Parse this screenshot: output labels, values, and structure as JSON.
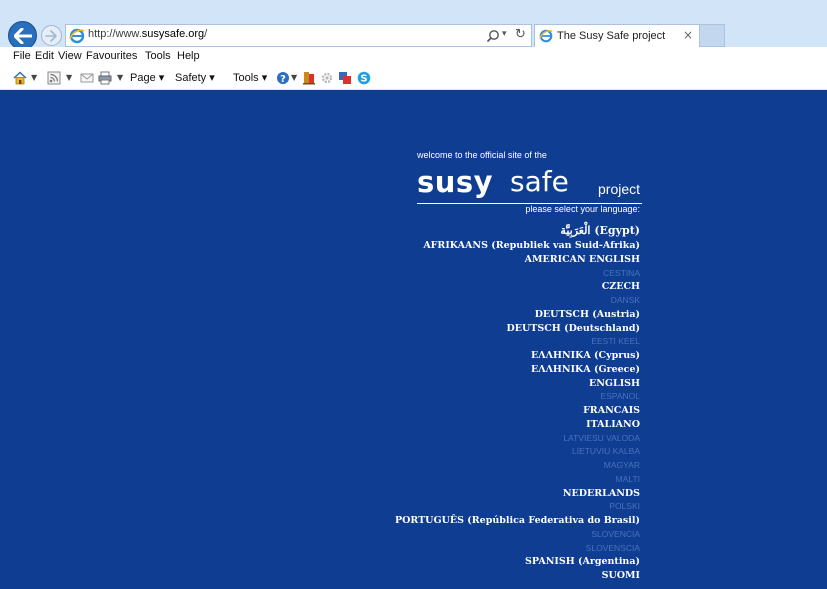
{
  "browser": {
    "url_prefix": "http://www.",
    "url_domain": "susysafe.org",
    "url_suffix": "/",
    "tab_title": "The Susy Safe project",
    "tab_close": "×"
  },
  "menu": {
    "file": "File",
    "edit": "Edit",
    "view": "View",
    "favourites": "Favourites",
    "tools": "Tools",
    "help": "Help"
  },
  "commandbar": {
    "page": "Page",
    "safety": "Safety",
    "tools": "Tools"
  },
  "page": {
    "welcome": "welcome to the official site of the",
    "logo_susy": "susy",
    "logo_safe": "safe",
    "logo_project": "project",
    "select_language": "please select your language:",
    "languages": [
      {
        "label": "(Egypt) الْعَرَبِيَّة",
        "active": true
      },
      {
        "label": "AFRIKAANS (Republiek van Suid-Afrika)",
        "active": true
      },
      {
        "label": "AMERICAN ENGLISH",
        "active": true
      },
      {
        "label": "CESTINA",
        "active": false
      },
      {
        "label": "CZECH",
        "active": true
      },
      {
        "label": "DANSK",
        "active": false
      },
      {
        "label": "DEUTSCH (Austria)",
        "active": true
      },
      {
        "label": "DEUTSCH (Deutschland)",
        "active": true
      },
      {
        "label": "EESTI KEEL",
        "active": false
      },
      {
        "label": "ΕΛΛΗΝΙΚΑ (Cyprus)",
        "active": true
      },
      {
        "label": "ΕΛΛΗΝΙΚΑ (Greece)",
        "active": true
      },
      {
        "label": "ENGLISH",
        "active": true
      },
      {
        "label": "ESPANOL",
        "active": false
      },
      {
        "label": "FRANCAIS",
        "active": true
      },
      {
        "label": "ITALIANO",
        "active": true
      },
      {
        "label": "LATVIESU VALODA",
        "active": false
      },
      {
        "label": "LIETUVIU KALBA",
        "active": false
      },
      {
        "label": "MAGYAR",
        "active": false
      },
      {
        "label": "MALTI",
        "active": false
      },
      {
        "label": "NEDERLANDS",
        "active": true
      },
      {
        "label": "POLSKI",
        "active": false
      },
      {
        "label": "PORTUGUÊS (República Federativa do Brasil)",
        "active": true
      },
      {
        "label": "SLOVENCIA",
        "active": false
      },
      {
        "label": "SLOVENSCIA",
        "active": false
      },
      {
        "label": "SPANISH (Argentina)",
        "active": true
      },
      {
        "label": "SUOMI",
        "active": true
      }
    ]
  },
  "colors": {
    "page_background": "#0e3d91",
    "active_language": "#ffffff",
    "inactive_language": "#4a72bd",
    "chrome": "#d2e4f7"
  }
}
